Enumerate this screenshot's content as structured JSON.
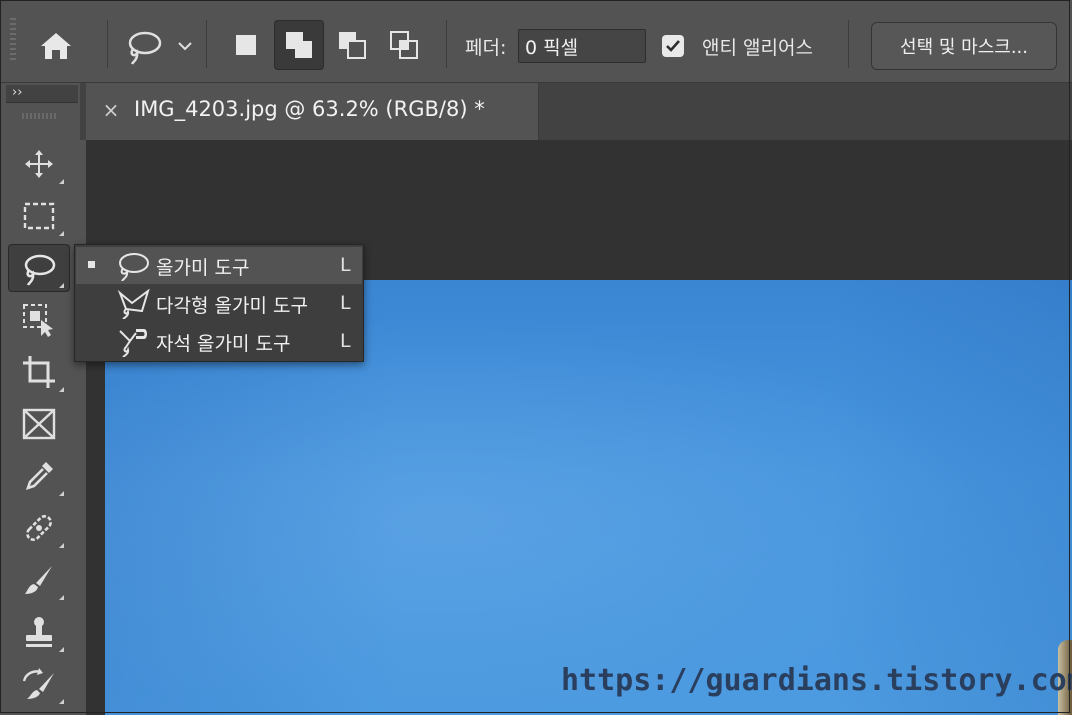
{
  "options_bar": {
    "feather_label": "페더:",
    "feather_value": "0 픽셀",
    "anti_alias_label": "앤티 앨리어스",
    "anti_alias_checked": true,
    "select_mask_label": "선택 및 마스크..."
  },
  "document": {
    "tab_title": "IMG_4203.jpg @ 63.2% (RGB/8) *",
    "close_glyph": "×",
    "sky_color": "#4795de"
  },
  "toolbar": {
    "collapse_glyph": "››",
    "tools": [
      {
        "name": "move-tool",
        "icon": "move-icon"
      },
      {
        "name": "marquee-tool",
        "icon": "rect-marquee-icon"
      },
      {
        "name": "lasso-tool",
        "icon": "lasso-icon",
        "active": true
      },
      {
        "name": "object-select-tool",
        "icon": "object-select-icon"
      },
      {
        "name": "crop-tool",
        "icon": "crop-icon"
      },
      {
        "name": "frame-tool",
        "icon": "frame-icon"
      },
      {
        "name": "eyedropper-tool",
        "icon": "eyedropper-icon"
      },
      {
        "name": "healing-tool",
        "icon": "bandage-icon"
      },
      {
        "name": "brush-tool",
        "icon": "brush-icon"
      },
      {
        "name": "stamp-tool",
        "icon": "stamp-icon"
      },
      {
        "name": "history-brush-tool",
        "icon": "history-brush-icon"
      }
    ]
  },
  "flyout": {
    "items": [
      {
        "label": "올가미 도구",
        "key": "L",
        "selected": true,
        "icon": "lasso-icon"
      },
      {
        "label": "다각형 올가미 도구",
        "key": "L",
        "selected": false,
        "icon": "polygonal-lasso-icon"
      },
      {
        "label": "자석 올가미 도구",
        "key": "L",
        "selected": false,
        "icon": "magnetic-lasso-icon"
      }
    ]
  },
  "watermark": "https://guardians.tistory.com/"
}
